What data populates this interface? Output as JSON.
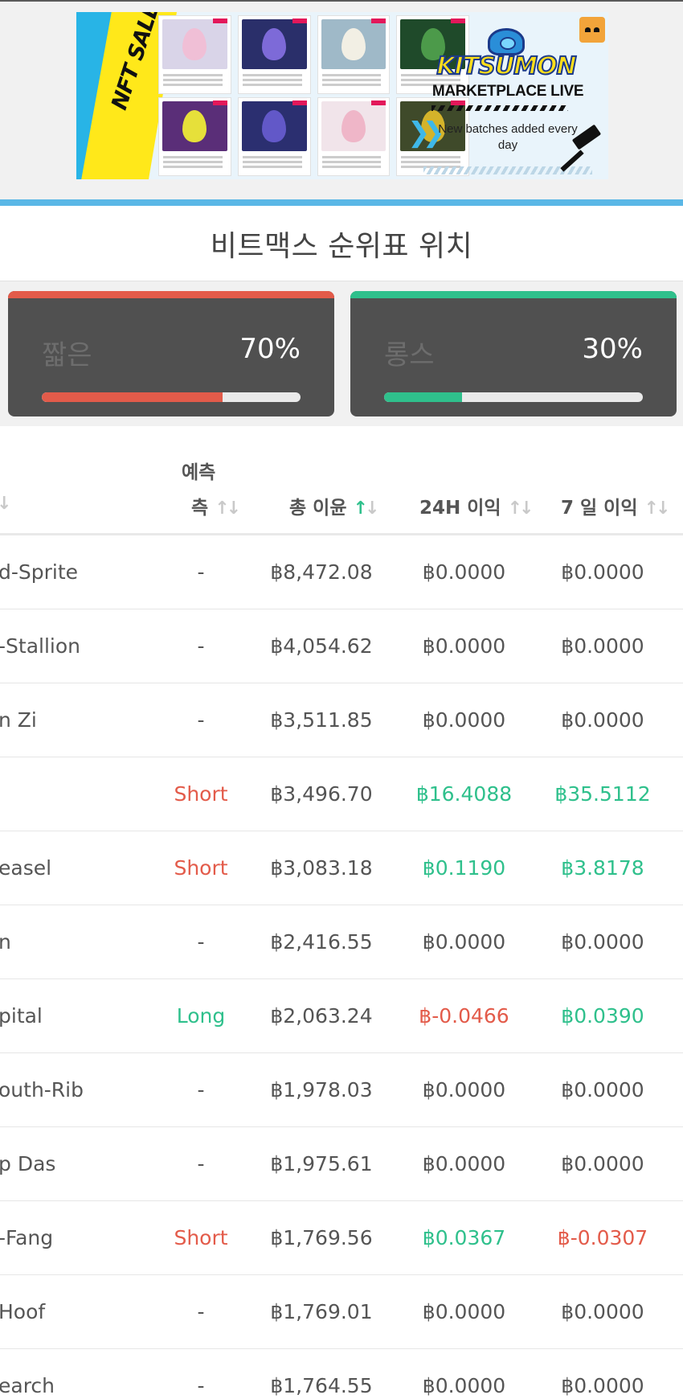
{
  "ad": {
    "nft_sale_text": "NFT SALE",
    "brand": "KITSUMON",
    "headline": "MARKETPLACE LIVE",
    "subline": "New batches added every day",
    "card_egg_colors": [
      "#f0bfd6",
      "#7d6ad8",
      "#f2efe4",
      "#4c9a4a",
      "#e6e03a",
      "#6258c8",
      "#efb6c8",
      "#d4b32a"
    ],
    "card_bg_colors": [
      "#d9d4e8",
      "#2a2f6a",
      "#9fb9c8",
      "#1f4a2a",
      "#5a2e78",
      "#2b2f70",
      "#f1e4ea",
      "#3f4a2a"
    ]
  },
  "page": {
    "title": "비트맥스 순위표 위치"
  },
  "positions": {
    "short": {
      "label": "짧은",
      "percent_text": "70%",
      "value": 70,
      "color": "#e35b4a"
    },
    "long": {
      "label": "롱스",
      "percent_text": "30%",
      "value": 30,
      "color": "#2fc08c"
    }
  },
  "table": {
    "columns": {
      "name_arrow": "↓",
      "prediction_line1": "예측",
      "prediction_line2": "측",
      "total": "총 이윤",
      "h24": "24H 이익",
      "d7": "7 일 이익",
      "sort_up": "↑",
      "sort_down": "↓"
    },
    "rows": [
      {
        "name": "d-Sprite",
        "prediction": "-",
        "prediction_type": "none",
        "total": "฿8,472.08",
        "h24": "฿0.0000",
        "h24_type": "zero",
        "d7": "฿0.0000",
        "d7_type": "zero"
      },
      {
        "name": "-Stallion",
        "prediction": "-",
        "prediction_type": "none",
        "total": "฿4,054.62",
        "h24": "฿0.0000",
        "h24_type": "zero",
        "d7": "฿0.0000",
        "d7_type": "zero"
      },
      {
        "name": "n Zi",
        "prediction": "-",
        "prediction_type": "none",
        "total": "฿3,511.85",
        "h24": "฿0.0000",
        "h24_type": "zero",
        "d7": "฿0.0000",
        "d7_type": "zero"
      },
      {
        "name": "",
        "prediction": "Short",
        "prediction_type": "short",
        "total": "฿3,496.70",
        "h24": "฿16.4088",
        "h24_type": "pos",
        "d7": "฿35.5112",
        "d7_type": "pos"
      },
      {
        "name": "easel",
        "prediction": "Short",
        "prediction_type": "short",
        "total": "฿3,083.18",
        "h24": "฿0.1190",
        "h24_type": "pos",
        "d7": "฿3.8178",
        "d7_type": "pos"
      },
      {
        "name": "n",
        "prediction": "-",
        "prediction_type": "none",
        "total": "฿2,416.55",
        "h24": "฿0.0000",
        "h24_type": "zero",
        "d7": "฿0.0000",
        "d7_type": "zero"
      },
      {
        "name": "pital",
        "prediction": "Long",
        "prediction_type": "long",
        "total": "฿2,063.24",
        "h24": "฿-0.0466",
        "h24_type": "neg",
        "d7": "฿0.0390",
        "d7_type": "pos"
      },
      {
        "name": "outh-Rib",
        "prediction": "-",
        "prediction_type": "none",
        "total": "฿1,978.03",
        "h24": "฿0.0000",
        "h24_type": "zero",
        "d7": "฿0.0000",
        "d7_type": "zero"
      },
      {
        "name": "p Das",
        "prediction": "-",
        "prediction_type": "none",
        "total": "฿1,975.61",
        "h24": "฿0.0000",
        "h24_type": "zero",
        "d7": "฿0.0000",
        "d7_type": "zero"
      },
      {
        "name": "-Fang",
        "prediction": "Short",
        "prediction_type": "short",
        "total": "฿1,769.56",
        "h24": "฿0.0367",
        "h24_type": "pos",
        "d7": "฿-0.0307",
        "d7_type": "neg"
      },
      {
        "name": "Hoof",
        "prediction": "-",
        "prediction_type": "none",
        "total": "฿1,769.01",
        "h24": "฿0.0000",
        "h24_type": "zero",
        "d7": "฿0.0000",
        "d7_type": "zero"
      },
      {
        "name": "earch",
        "prediction": "-",
        "prediction_type": "none",
        "total": "฿1,764.55",
        "h24": "฿0.0000",
        "h24_type": "zero",
        "d7": "฿0.0000",
        "d7_type": "zero"
      }
    ]
  }
}
